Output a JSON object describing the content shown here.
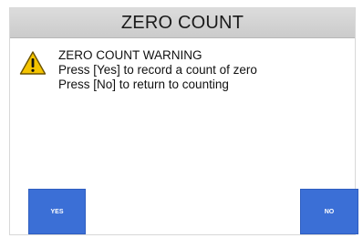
{
  "dialog": {
    "title": "ZERO COUNT",
    "icon": "warning-icon",
    "message_lines": [
      "ZERO COUNT WARNING",
      "Press [Yes] to record a count of zero",
      "Press [No] to return to counting"
    ],
    "buttons": {
      "yes_label": "YES",
      "no_label": "NO"
    }
  },
  "colors": {
    "title_bar": "#d3d3d3",
    "button": "#3b6fd6",
    "warning_fill": "#f5c400"
  }
}
